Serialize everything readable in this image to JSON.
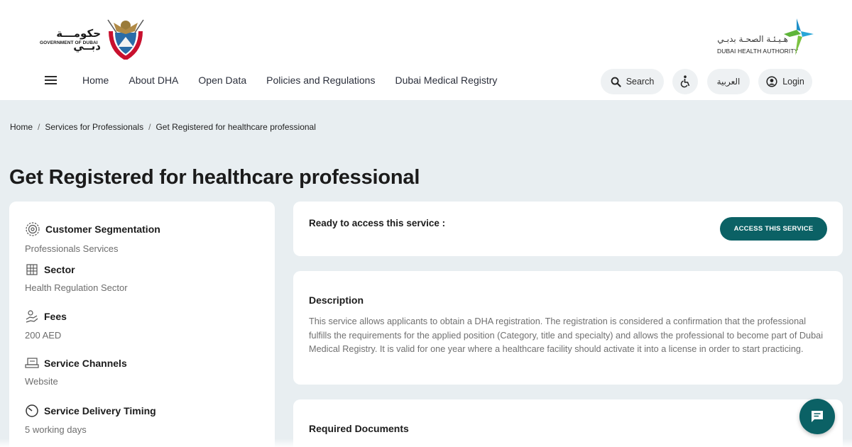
{
  "header": {
    "gov_logo": {
      "arabic": "حكومـــة دبــي",
      "english": "GOVERNMENT OF DUBAI"
    },
    "dha_logo": {
      "arabic": "هـيـئـة الصحـة بدبـي",
      "english": "DUBAI HEALTH AUTHORITY"
    },
    "nav": [
      {
        "label": "Home"
      },
      {
        "label": "About DHA"
      },
      {
        "label": "Open Data"
      },
      {
        "label": "Policies and Regulations"
      },
      {
        "label": "Dubai Medical Registry"
      }
    ],
    "search_label": "Search",
    "arabic_label": "العربية",
    "login_label": "Login"
  },
  "breadcrumb": [
    {
      "label": "Home"
    },
    {
      "label": "Services for Professionals"
    },
    {
      "label": "Get Registered for healthcare professional"
    }
  ],
  "page_title": "Get Registered for healthcare professional",
  "info": {
    "items": [
      {
        "label": "Customer Segmentation",
        "value": "Professionals Services",
        "icon": "gear-icon"
      },
      {
        "label": "Sector",
        "value": "Health Regulation Sector",
        "icon": "building-icon"
      },
      {
        "label": "Fees",
        "value": "200 AED",
        "icon": "hand-coins-icon"
      },
      {
        "label": "Service Channels",
        "value": "Website",
        "icon": "laptop-icon"
      },
      {
        "label": "Service Delivery Timing",
        "value": "5 working days",
        "icon": "clock-icon"
      }
    ]
  },
  "access": {
    "label": "Ready to access this service :",
    "button_label": "ACCESS THIS SERVICE"
  },
  "description": {
    "title": "Description",
    "body": "This service allows applicants to obtain a DHA registration. The registration is considered a confirmation that the professional fulfills the requirements for the applied position (Category, title and specialty) and allows the professional to become part of Dubai Medical Registry. It is valid for one year where a healthcare facility should activate it into a license in order to start practicing."
  },
  "documents": {
    "title": "Required Documents"
  },
  "colors": {
    "accent": "#0b6165",
    "page_bg": "#e8eef1",
    "card_bg": "#ffffff"
  }
}
